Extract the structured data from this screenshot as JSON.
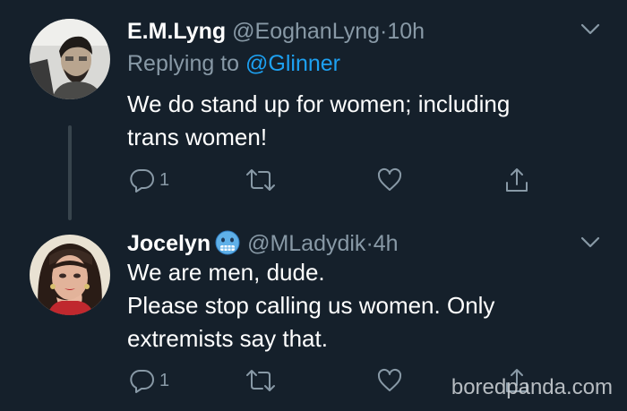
{
  "tweets": [
    {
      "display_name": "E.M.Lyng",
      "handle": "@EoghanLyng",
      "separator": "·",
      "time": "10h",
      "replying_prefix": "Replying to",
      "replying_to": "@Glinner",
      "body_lines": [
        "We do stand up for women; including",
        "trans women!"
      ],
      "reply_count": "1"
    },
    {
      "display_name": "Jocelyn",
      "emoji_icon": "cold-face-emoji-icon",
      "handle": "@MLadydik",
      "separator": "·",
      "time": "4h",
      "body_lines": [
        "We are men, dude.",
        "Please stop calling us women. Only",
        "extremists say that."
      ],
      "reply_count": "1"
    }
  ],
  "watermark": "boredpanda.com",
  "colors": {
    "background": "#15202b",
    "secondary_text": "#8899a6",
    "link": "#1da1f2",
    "thread_line": "#38444d"
  }
}
